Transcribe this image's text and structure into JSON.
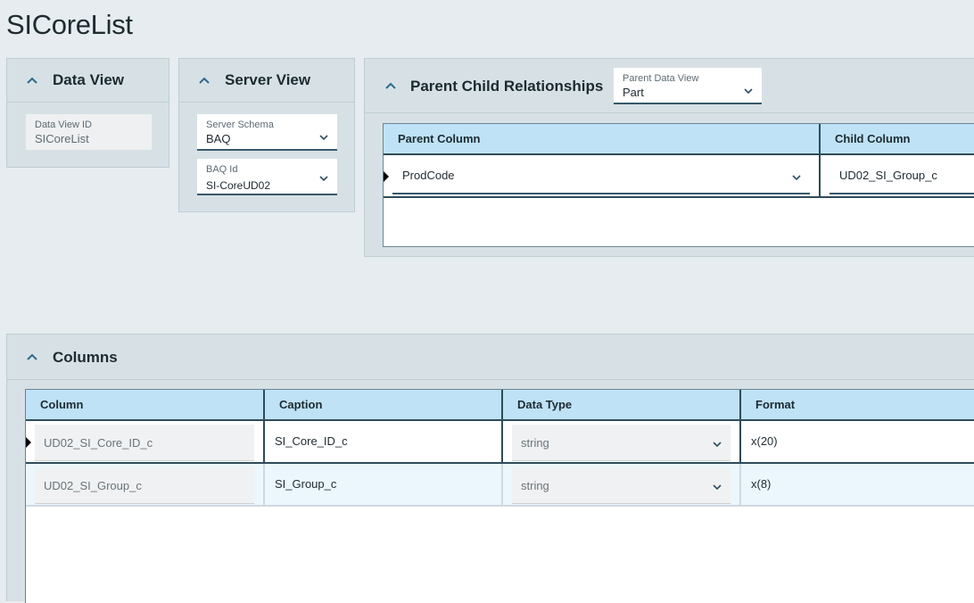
{
  "page": {
    "title": "SICoreList"
  },
  "data_view": {
    "title": "Data View",
    "id_label": "Data View ID",
    "id_value": "SICoreList"
  },
  "server_view": {
    "title": "Server View",
    "schema_label": "Server Schema",
    "schema_value": "BAQ",
    "baq_label": "BAQ Id",
    "baq_value": "SI-CoreUD02"
  },
  "parent_child": {
    "title": "Parent Child Relationships",
    "parent_view_label": "Parent Data View",
    "parent_view_value": "Part",
    "headers": [
      "Parent Column",
      "Child Column"
    ],
    "rows": [
      {
        "parent": "ProdCode",
        "child": "UD02_SI_Group_c"
      }
    ]
  },
  "columns": {
    "title": "Columns",
    "headers": [
      "Column",
      "Caption",
      "Data Type",
      "Format"
    ],
    "rows": [
      {
        "column": "UD02_SI_Core_ID_c",
        "caption": "SI_Core_ID_c",
        "data_type": "string",
        "format": "x(20)"
      },
      {
        "column": "UD02_SI_Group_c",
        "caption": "SI_Group_c",
        "data_type": "string",
        "format": "x(8)"
      }
    ]
  },
  "colors": {
    "page_bg": "#e6ecef",
    "panel_bg": "#d7e1e5",
    "grid_header_bg": "#bfe2f6",
    "selected_row_bg": "#ebf6fd",
    "accent": "#37586a"
  },
  "icons": {
    "collapse": "chevron-up-icon",
    "dropdown": "chevron-down-icon",
    "current_row": "row-indicator-icon"
  }
}
